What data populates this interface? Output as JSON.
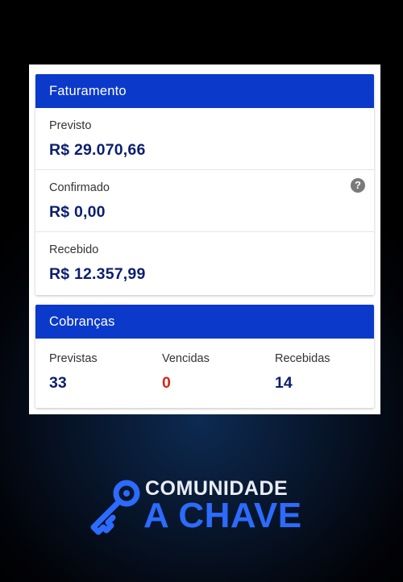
{
  "faturamento": {
    "title": "Faturamento",
    "previsto_label": "Previsto",
    "previsto_value": "R$ 29.070,66",
    "confirmado_label": "Confirmado",
    "confirmado_value": "R$ 0,00",
    "recebido_label": "Recebido",
    "recebido_value": "R$ 12.357,99",
    "help_glyph": "?"
  },
  "cobrancas": {
    "title": "Cobranças",
    "previstas_label": "Previstas",
    "previstas_value": "33",
    "vencidas_label": "Vencidas",
    "vencidas_value": "0",
    "recebidas_label": "Recebidas",
    "recebidas_value": "14"
  },
  "logo": {
    "line1": "COMUNIDADE",
    "line2": "A CHAVE",
    "icon": "key-icon"
  },
  "colors": {
    "header_blue": "#0b39c9",
    "value_navy": "#0b1f6e",
    "overdue_red": "#d02a1a",
    "logo_blue": "#2d6bff"
  }
}
